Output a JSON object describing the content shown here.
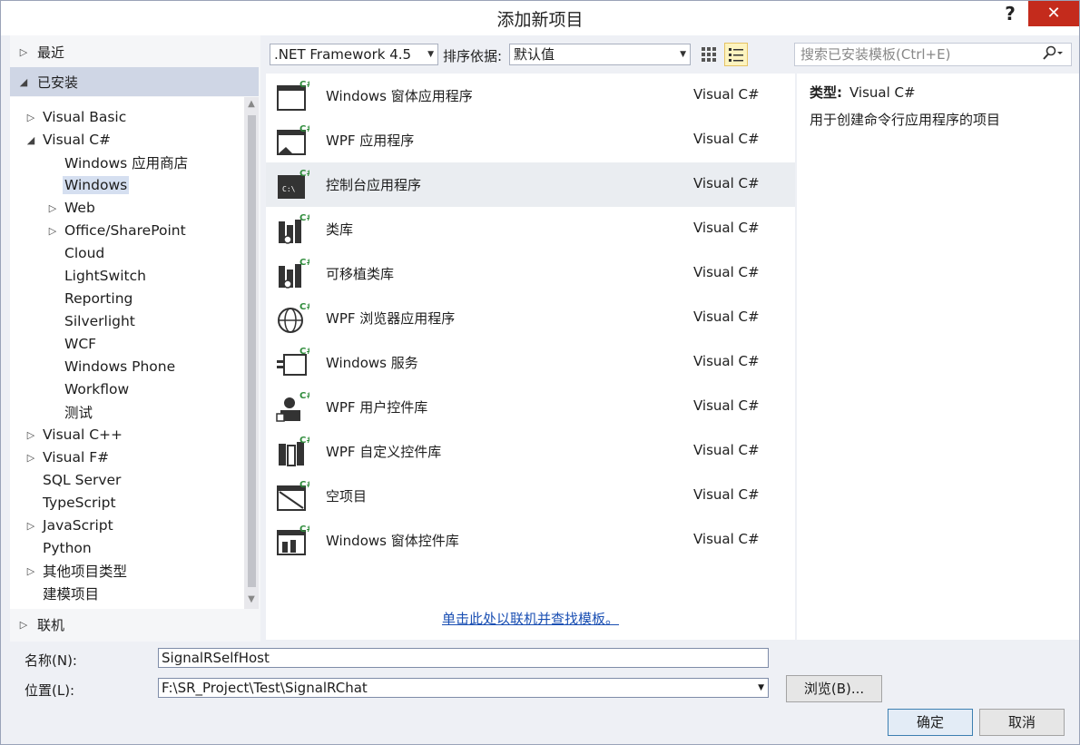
{
  "window": {
    "title": "添加新项目",
    "help": "?",
    "close": "✕"
  },
  "sidebar": {
    "recent": "最近",
    "installed": "已安装",
    "online": "联机",
    "tree": [
      {
        "label": "Visual Basic",
        "level": 0,
        "arrow": "right"
      },
      {
        "label": "Visual C#",
        "level": 0,
        "arrow": "down"
      },
      {
        "label": "Windows 应用商店",
        "level": 1,
        "arrow": ""
      },
      {
        "label": "Windows",
        "level": 1,
        "arrow": "",
        "selected": true
      },
      {
        "label": "Web",
        "level": 1,
        "arrow": "right"
      },
      {
        "label": "Office/SharePoint",
        "level": 1,
        "arrow": "right"
      },
      {
        "label": "Cloud",
        "level": 1,
        "arrow": ""
      },
      {
        "label": "LightSwitch",
        "level": 1,
        "arrow": ""
      },
      {
        "label": "Reporting",
        "level": 1,
        "arrow": ""
      },
      {
        "label": "Silverlight",
        "level": 1,
        "arrow": ""
      },
      {
        "label": "WCF",
        "level": 1,
        "arrow": ""
      },
      {
        "label": "Windows Phone",
        "level": 1,
        "arrow": ""
      },
      {
        "label": "Workflow",
        "level": 1,
        "arrow": ""
      },
      {
        "label": "测试",
        "level": 1,
        "arrow": ""
      },
      {
        "label": "Visual C++",
        "level": 0,
        "arrow": "right"
      },
      {
        "label": "Visual F#",
        "level": 0,
        "arrow": "right"
      },
      {
        "label": "SQL Server",
        "level": 0,
        "arrow": ""
      },
      {
        "label": "TypeScript",
        "level": 0,
        "arrow": ""
      },
      {
        "label": "JavaScript",
        "level": 0,
        "arrow": "right"
      },
      {
        "label": "Python",
        "level": 0,
        "arrow": ""
      },
      {
        "label": "其他项目类型",
        "level": 0,
        "arrow": "right"
      },
      {
        "label": "建模项目",
        "level": 0,
        "arrow": ""
      }
    ]
  },
  "toolbar": {
    "framework": ".NET Framework 4.5",
    "sort_label": "排序依据:",
    "sort_value": "默认值",
    "search_placeholder": "搜索已安装模板(Ctrl+E)"
  },
  "templates": [
    {
      "name": "Windows 窗体应用程序",
      "lang": "Visual C#",
      "icon": "windows-forms-icon"
    },
    {
      "name": "WPF 应用程序",
      "lang": "Visual C#",
      "icon": "wpf-app-icon"
    },
    {
      "name": "控制台应用程序",
      "lang": "Visual C#",
      "icon": "console-app-icon",
      "selected": true
    },
    {
      "name": "类库",
      "lang": "Visual C#",
      "icon": "class-library-icon"
    },
    {
      "name": "可移植类库",
      "lang": "Visual C#",
      "icon": "portable-library-icon"
    },
    {
      "name": "WPF 浏览器应用程序",
      "lang": "Visual C#",
      "icon": "wpf-browser-icon"
    },
    {
      "name": "Windows 服务",
      "lang": "Visual C#",
      "icon": "windows-service-icon"
    },
    {
      "name": "WPF 用户控件库",
      "lang": "Visual C#",
      "icon": "wpf-user-control-icon"
    },
    {
      "name": "WPF 自定义控件库",
      "lang": "Visual C#",
      "icon": "wpf-custom-control-icon"
    },
    {
      "name": "空项目",
      "lang": "Visual C#",
      "icon": "empty-project-icon"
    },
    {
      "name": "Windows 窗体控件库",
      "lang": "Visual C#",
      "icon": "winforms-control-icon"
    }
  ],
  "online_link": "单击此处以联机并查找模板。",
  "description": {
    "type_label": "类型:",
    "type_value": "Visual C#",
    "text": "用于创建命令行应用程序的项目"
  },
  "form": {
    "name_label": "名称(N):",
    "name_value": "SignalRSelfHost",
    "location_label": "位置(L):",
    "location_value": "F:\\SR_Project\\Test\\SignalRChat",
    "browse": "浏览(B)...",
    "ok": "确定",
    "cancel": "取消"
  },
  "colors": {
    "accent": "#1a4fb3",
    "close": "#c42b1c",
    "selected": "#d5dff0"
  }
}
